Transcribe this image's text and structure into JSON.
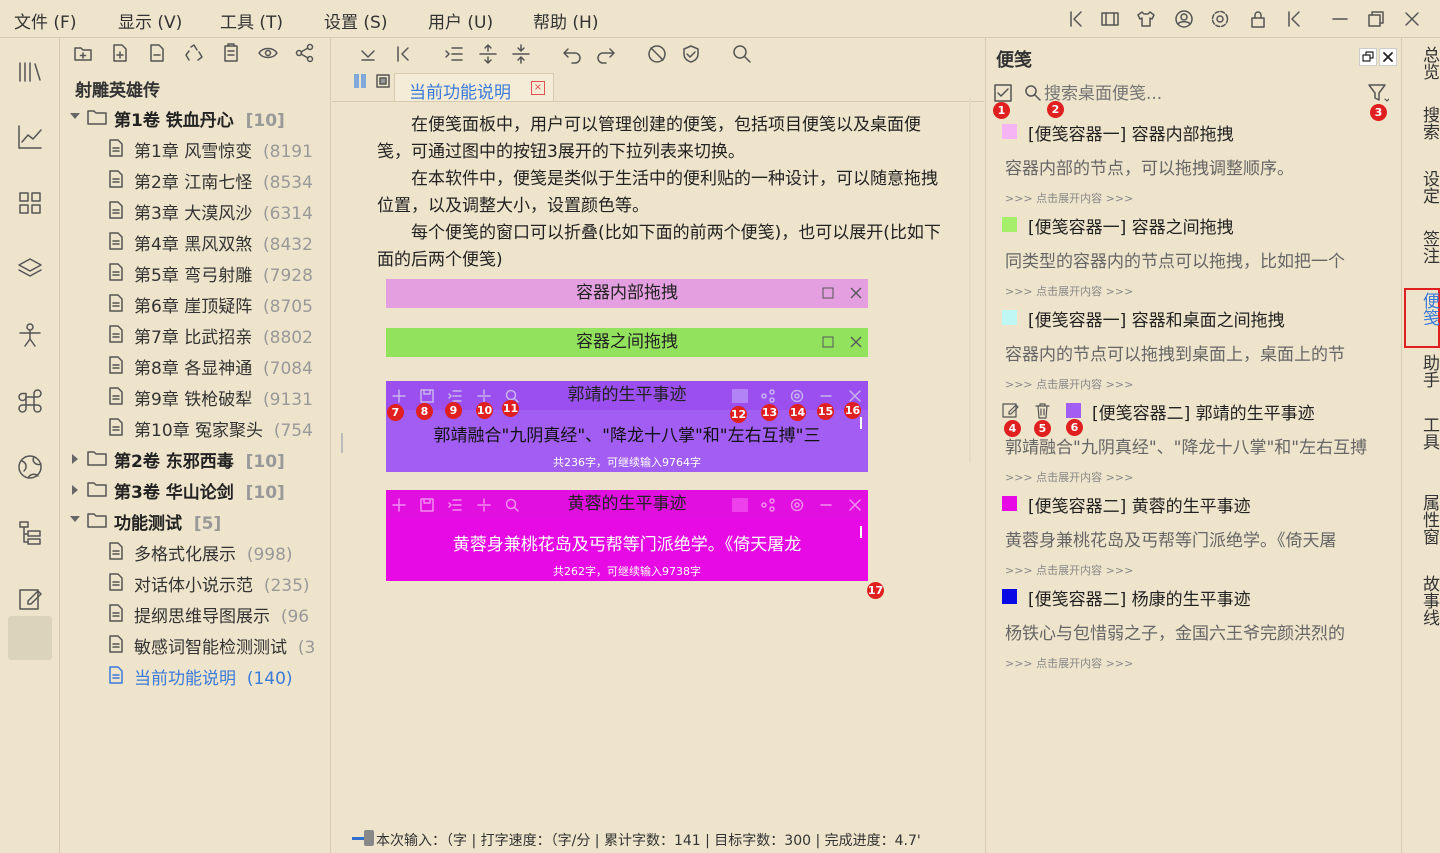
{
  "menu": [
    {
      "label": "文件 (F)"
    },
    {
      "label": "显示 (V)"
    },
    {
      "label": "工具 (T)"
    },
    {
      "label": "设置 (S)"
    },
    {
      "label": "用户 (U)"
    },
    {
      "label": "帮助 (H)"
    }
  ],
  "tree": {
    "book_title": "射雕英雄传",
    "rows": [
      {
        "label": "第1卷 铁血丹心",
        "count": "[10]"
      },
      {
        "label": "第1章 风雪惊变",
        "count": "(8191"
      },
      {
        "label": "第2章 江南七怪",
        "count": "(8534"
      },
      {
        "label": "第3章 大漠风沙",
        "count": "(6314"
      },
      {
        "label": "第4章 黑风双煞",
        "count": "(8432"
      },
      {
        "label": "第5章 弯弓射雕",
        "count": "(7928"
      },
      {
        "label": "第6章 崖顶疑阵",
        "count": "(8705"
      },
      {
        "label": "第7章 比武招亲",
        "count": "(8802"
      },
      {
        "label": "第8章 各显神通",
        "count": "(7084"
      },
      {
        "label": "第9章 铁枪破犁",
        "count": "(9131"
      },
      {
        "label": "第10章 冤家聚头",
        "count": "(754"
      },
      {
        "label": "第2卷 东邪西毒",
        "count": "[10]"
      },
      {
        "label": "第3卷 华山论剑",
        "count": "[10]"
      },
      {
        "label": "功能测试",
        "count": "[5]"
      },
      {
        "label": "多格式化展示",
        "count": "(998)"
      },
      {
        "label": "对话体小说示范",
        "count": "(235)"
      },
      {
        "label": "提纲思维导图展示",
        "count": "(96"
      },
      {
        "label": "敏感词智能检测测试",
        "count": "(3"
      },
      {
        "label": "当前功能说明",
        "count": "(140)"
      }
    ]
  },
  "editor": {
    "tab_label": "当前功能说明",
    "tab_close": "×",
    "paragraphs": [
      "在便笺面板中，用户可以管理创建的便笺，包括项目便笺以及桌面便笺，可通过图中的按钮3展开的下拉列表来切换。",
      "在本软件中，便笺是类似于生活中的便利贴的一种设计，可以随意拖拽位置，以及调整大小，设置颜色等。",
      "每个便笺的窗口可以折叠(比如下面的前两个便笺)，也可以展开(比如下面的后两个便笺)"
    ],
    "notes": [
      {
        "title": "容器内部拖拽",
        "color": "#e39fe0"
      },
      {
        "title": "容器之间拖拽",
        "color": "#93e25e"
      },
      {
        "title": "郭靖的生平事迹",
        "color": "#a25ef2",
        "body": "郭靖融合\"九阴真经\"、\"降龙十八掌\"和\"左右互搏\"三",
        "stat": "共236字，可继续输入9764字"
      },
      {
        "title": "黄蓉的生平事迹",
        "color": "#e80ae5",
        "body": "黄蓉身兼桃花岛及丐帮等门派绝学。《倚天屠龙",
        "stat": "共262字，可继续输入9738字"
      }
    ],
    "badges": [
      "7",
      "8",
      "9",
      "10",
      "11",
      "12",
      "13",
      "14",
      "15",
      "16",
      "17"
    ],
    "status": "本次输入：（字 | 打字速度：（字/分 | 累计字数：141 | 目标字数：300 | 完成进度：4.7'"
  },
  "panel": {
    "title": "便笺",
    "search_placeholder": "搜索桌面便笺...",
    "expand_text": ">>> 点击展开内容 >>>",
    "badges": [
      "1",
      "2",
      "3",
      "4",
      "5",
      "6"
    ],
    "notes": [
      {
        "title": "[便笺容器一] 容器内部拖拽",
        "body": "容器内部的节点，可以拖拽调整顺序。",
        "color": "#f7b4f4"
      },
      {
        "title": "[便笺容器一] 容器之间拖拽",
        "body": "同类型的容器内的节点可以拖拽，比如把一个",
        "color": "#a6ef6b"
      },
      {
        "title": "[便笺容器一] 容器和桌面之间拖拽",
        "body": "容器内的节点可以拖拽到桌面上，桌面上的节",
        "color": "#bff7f5"
      },
      {
        "title": "[便笺容器二] 郭靖的生平事迹",
        "body": "郭靖融合\"九阴真经\"、\"降龙十八掌\"和\"左右互搏",
        "color": "#a25ef2"
      },
      {
        "title": "[便笺容器二] 黄蓉的生平事迹",
        "body": "黄蓉身兼桃花岛及丐帮等门派绝学。《倚天屠",
        "color": "#e80ae5"
      },
      {
        "title": "[便笺容器二] 杨康的生平事迹",
        "body": "杨铁心与包惜弱之子，金国六王爷完颜洪烈的",
        "color": "#0a0ae5"
      }
    ]
  },
  "rail": [
    {
      "label": "总览"
    },
    {
      "label": "搜索"
    },
    {
      "label": "设定"
    },
    {
      "label": "签注"
    },
    {
      "label": "便笺"
    },
    {
      "label": "助手"
    },
    {
      "label": "工具"
    },
    {
      "label": "属性窗"
    },
    {
      "label": "故事线"
    }
  ]
}
